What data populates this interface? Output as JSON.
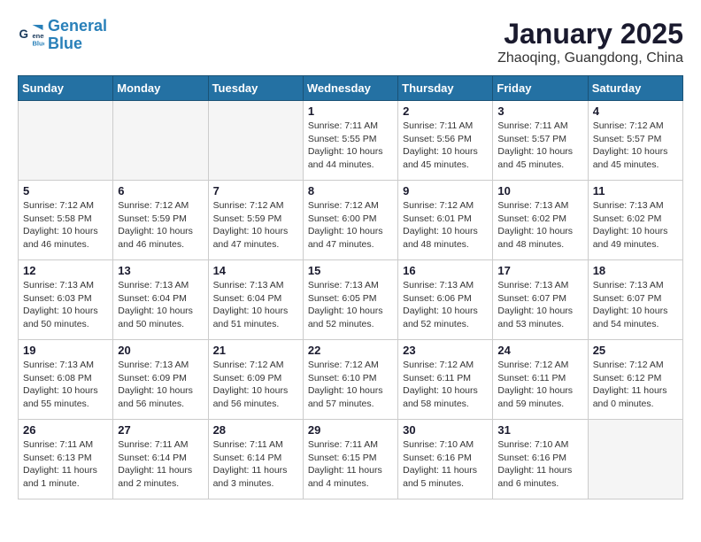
{
  "header": {
    "logo_line1": "General",
    "logo_line2": "Blue",
    "month_year": "January 2025",
    "location": "Zhaoqing, Guangdong, China"
  },
  "weekdays": [
    "Sunday",
    "Monday",
    "Tuesday",
    "Wednesday",
    "Thursday",
    "Friday",
    "Saturday"
  ],
  "weeks": [
    [
      {
        "day": "",
        "info": "",
        "empty": true
      },
      {
        "day": "",
        "info": "",
        "empty": true
      },
      {
        "day": "",
        "info": "",
        "empty": true
      },
      {
        "day": "1",
        "info": "Sunrise: 7:11 AM\nSunset: 5:55 PM\nDaylight: 10 hours\nand 44 minutes."
      },
      {
        "day": "2",
        "info": "Sunrise: 7:11 AM\nSunset: 5:56 PM\nDaylight: 10 hours\nand 45 minutes."
      },
      {
        "day": "3",
        "info": "Sunrise: 7:11 AM\nSunset: 5:57 PM\nDaylight: 10 hours\nand 45 minutes."
      },
      {
        "day": "4",
        "info": "Sunrise: 7:12 AM\nSunset: 5:57 PM\nDaylight: 10 hours\nand 45 minutes."
      }
    ],
    [
      {
        "day": "5",
        "info": "Sunrise: 7:12 AM\nSunset: 5:58 PM\nDaylight: 10 hours\nand 46 minutes."
      },
      {
        "day": "6",
        "info": "Sunrise: 7:12 AM\nSunset: 5:59 PM\nDaylight: 10 hours\nand 46 minutes."
      },
      {
        "day": "7",
        "info": "Sunrise: 7:12 AM\nSunset: 5:59 PM\nDaylight: 10 hours\nand 47 minutes."
      },
      {
        "day": "8",
        "info": "Sunrise: 7:12 AM\nSunset: 6:00 PM\nDaylight: 10 hours\nand 47 minutes."
      },
      {
        "day": "9",
        "info": "Sunrise: 7:12 AM\nSunset: 6:01 PM\nDaylight: 10 hours\nand 48 minutes."
      },
      {
        "day": "10",
        "info": "Sunrise: 7:13 AM\nSunset: 6:02 PM\nDaylight: 10 hours\nand 48 minutes."
      },
      {
        "day": "11",
        "info": "Sunrise: 7:13 AM\nSunset: 6:02 PM\nDaylight: 10 hours\nand 49 minutes."
      }
    ],
    [
      {
        "day": "12",
        "info": "Sunrise: 7:13 AM\nSunset: 6:03 PM\nDaylight: 10 hours\nand 50 minutes."
      },
      {
        "day": "13",
        "info": "Sunrise: 7:13 AM\nSunset: 6:04 PM\nDaylight: 10 hours\nand 50 minutes."
      },
      {
        "day": "14",
        "info": "Sunrise: 7:13 AM\nSunset: 6:04 PM\nDaylight: 10 hours\nand 51 minutes."
      },
      {
        "day": "15",
        "info": "Sunrise: 7:13 AM\nSunset: 6:05 PM\nDaylight: 10 hours\nand 52 minutes."
      },
      {
        "day": "16",
        "info": "Sunrise: 7:13 AM\nSunset: 6:06 PM\nDaylight: 10 hours\nand 52 minutes."
      },
      {
        "day": "17",
        "info": "Sunrise: 7:13 AM\nSunset: 6:07 PM\nDaylight: 10 hours\nand 53 minutes."
      },
      {
        "day": "18",
        "info": "Sunrise: 7:13 AM\nSunset: 6:07 PM\nDaylight: 10 hours\nand 54 minutes."
      }
    ],
    [
      {
        "day": "19",
        "info": "Sunrise: 7:13 AM\nSunset: 6:08 PM\nDaylight: 10 hours\nand 55 minutes."
      },
      {
        "day": "20",
        "info": "Sunrise: 7:13 AM\nSunset: 6:09 PM\nDaylight: 10 hours\nand 56 minutes."
      },
      {
        "day": "21",
        "info": "Sunrise: 7:12 AM\nSunset: 6:09 PM\nDaylight: 10 hours\nand 56 minutes."
      },
      {
        "day": "22",
        "info": "Sunrise: 7:12 AM\nSunset: 6:10 PM\nDaylight: 10 hours\nand 57 minutes."
      },
      {
        "day": "23",
        "info": "Sunrise: 7:12 AM\nSunset: 6:11 PM\nDaylight: 10 hours\nand 58 minutes."
      },
      {
        "day": "24",
        "info": "Sunrise: 7:12 AM\nSunset: 6:11 PM\nDaylight: 10 hours\nand 59 minutes."
      },
      {
        "day": "25",
        "info": "Sunrise: 7:12 AM\nSunset: 6:12 PM\nDaylight: 11 hours\nand 0 minutes."
      }
    ],
    [
      {
        "day": "26",
        "info": "Sunrise: 7:11 AM\nSunset: 6:13 PM\nDaylight: 11 hours\nand 1 minute."
      },
      {
        "day": "27",
        "info": "Sunrise: 7:11 AM\nSunset: 6:14 PM\nDaylight: 11 hours\nand 2 minutes."
      },
      {
        "day": "28",
        "info": "Sunrise: 7:11 AM\nSunset: 6:14 PM\nDaylight: 11 hours\nand 3 minutes."
      },
      {
        "day": "29",
        "info": "Sunrise: 7:11 AM\nSunset: 6:15 PM\nDaylight: 11 hours\nand 4 minutes."
      },
      {
        "day": "30",
        "info": "Sunrise: 7:10 AM\nSunset: 6:16 PM\nDaylight: 11 hours\nand 5 minutes."
      },
      {
        "day": "31",
        "info": "Sunrise: 7:10 AM\nSunset: 6:16 PM\nDaylight: 11 hours\nand 6 minutes."
      },
      {
        "day": "",
        "info": "",
        "empty": true
      }
    ]
  ]
}
